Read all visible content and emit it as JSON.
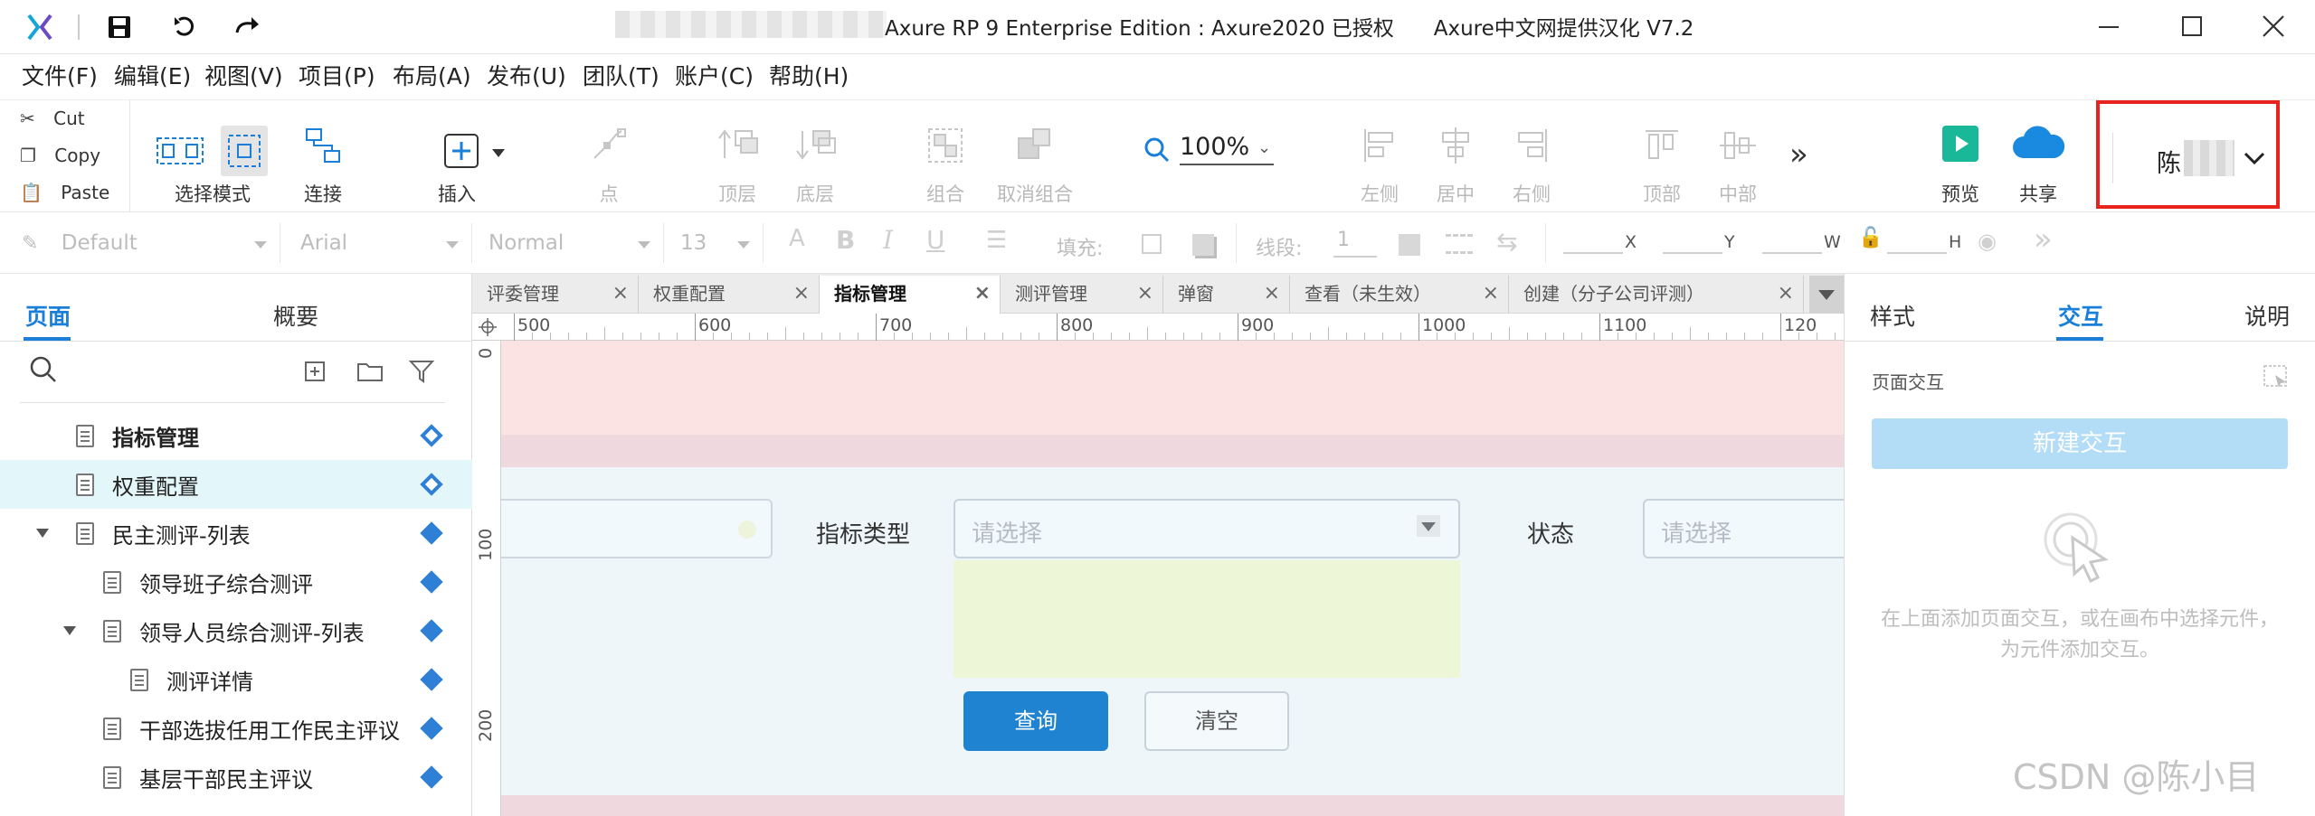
{
  "window": {
    "title": "Axure RP 9 Enterprise Edition : Axure2020 已授权      Axure中文网提供汉化 V7.2",
    "controls": [
      "minimize",
      "maximize",
      "close"
    ]
  },
  "menu": [
    "文件(F)",
    "编辑(E)",
    "视图(V)",
    "项目(P)",
    "布局(A)",
    "发布(U)",
    "团队(T)",
    "账户(C)",
    "帮助(H)"
  ],
  "clipboard": {
    "cut": "Cut",
    "copy": "Copy",
    "paste": "Paste"
  },
  "toolbar": {
    "select_mode": "选择模式",
    "connect": "连接",
    "insert": "插入",
    "point": "点",
    "top_layer": "顶层",
    "bottom_layer": "底层",
    "group": "组合",
    "ungroup": "取消组合",
    "zoom": "100%",
    "align_left": "左侧",
    "align_center": "居中",
    "align_right": "右侧",
    "align_top": "顶部",
    "align_middle": "中部",
    "preview": "预览",
    "share": "共享",
    "user": "陈"
  },
  "format": {
    "style": "Default",
    "font": "Arial",
    "weight": "Normal",
    "size": "13",
    "fill_label": "填充:",
    "stroke_label": "线段:",
    "stroke_value": "1",
    "x_label": "X",
    "y_label": "Y",
    "w_label": "W",
    "h_label": "H"
  },
  "left_panel": {
    "tabs": [
      "页面",
      "概要"
    ],
    "pages": [
      {
        "label": "指标管理",
        "indent": 0,
        "bold": true,
        "hollow": true,
        "expand": false,
        "selected": false
      },
      {
        "label": "权重配置",
        "indent": 0,
        "bold": false,
        "hollow": true,
        "expand": false,
        "selected": true
      },
      {
        "label": "民主测评-列表",
        "indent": 0,
        "bold": false,
        "hollow": false,
        "expand": true,
        "selected": false
      },
      {
        "label": "领导班子综合测评",
        "indent": 1,
        "bold": false,
        "hollow": false,
        "expand": false,
        "selected": false
      },
      {
        "label": "领导人员综合测评-列表",
        "indent": 1,
        "bold": false,
        "hollow": false,
        "expand": true,
        "selected": false
      },
      {
        "label": "测评详情",
        "indent": 2,
        "bold": false,
        "hollow": false,
        "expand": false,
        "selected": false
      },
      {
        "label": "干部选拔任用工作民主评议",
        "indent": 1,
        "bold": false,
        "hollow": false,
        "expand": false,
        "selected": false
      },
      {
        "label": "基层干部民主评议",
        "indent": 1,
        "bold": false,
        "hollow": false,
        "expand": false,
        "selected": false
      }
    ]
  },
  "doc_tabs": [
    {
      "label": "评委管理",
      "active": false
    },
    {
      "label": "权重配置",
      "active": false
    },
    {
      "label": "指标管理",
      "active": true
    },
    {
      "label": "测评管理",
      "active": false
    },
    {
      "label": "弹窗",
      "active": false
    },
    {
      "label": "查看（未生效）",
      "active": false
    },
    {
      "label": "创建（分子公司评测）",
      "active": false
    }
  ],
  "ruler": {
    "h": [
      "500",
      "600",
      "700",
      "800",
      "900",
      "1000",
      "1100",
      "120"
    ],
    "v": [
      "0",
      "100",
      "200"
    ]
  },
  "canvas": {
    "indicator_type_label": "指标类型",
    "indicator_type_placeholder": "请选择",
    "status_label": "状态",
    "status_placeholder": "请选择",
    "query_button": "查询",
    "clear_button": "清空"
  },
  "right_panel": {
    "tabs": [
      "样式",
      "交互",
      "说明"
    ],
    "active_tab": "交互",
    "section_title": "页面交互",
    "new_interaction": "新建交互",
    "hint": "在上面添加页面交互，或在画布中选择元件，为元件添加交互。"
  },
  "watermark": "CSDN @陈小目",
  "colors": {
    "accent": "#1a7fd8",
    "query_button": "#2083d2",
    "new_interaction_bg": "#b3dcf7",
    "highlight_red": "#e8231e",
    "selected_row": "#e3f7fa",
    "preview_green": "#18b898"
  }
}
